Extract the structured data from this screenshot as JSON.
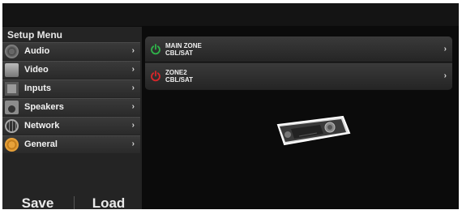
{
  "sidebar": {
    "title": "Setup Menu",
    "items": [
      {
        "label": "Audio",
        "icon": "speaker-cone-icon"
      },
      {
        "label": "Video",
        "icon": "monitor-icon"
      },
      {
        "label": "Inputs",
        "icon": "input-jack-icon"
      },
      {
        "label": "Speakers",
        "icon": "speaker-box-icon"
      },
      {
        "label": "Network",
        "icon": "globe-icon"
      },
      {
        "label": "General",
        "icon": "gear-icon"
      }
    ],
    "chevron": "›",
    "save_label": "Save",
    "load_label": "Load"
  },
  "zones": [
    {
      "name": "MAIN ZONE",
      "source": "CBL/SAT",
      "power": "on",
      "color": "#2fb34a"
    },
    {
      "name": "ZONE2",
      "source": "CBL/SAT",
      "power": "off",
      "color": "#d8262a"
    }
  ],
  "zone_chevron": "›"
}
